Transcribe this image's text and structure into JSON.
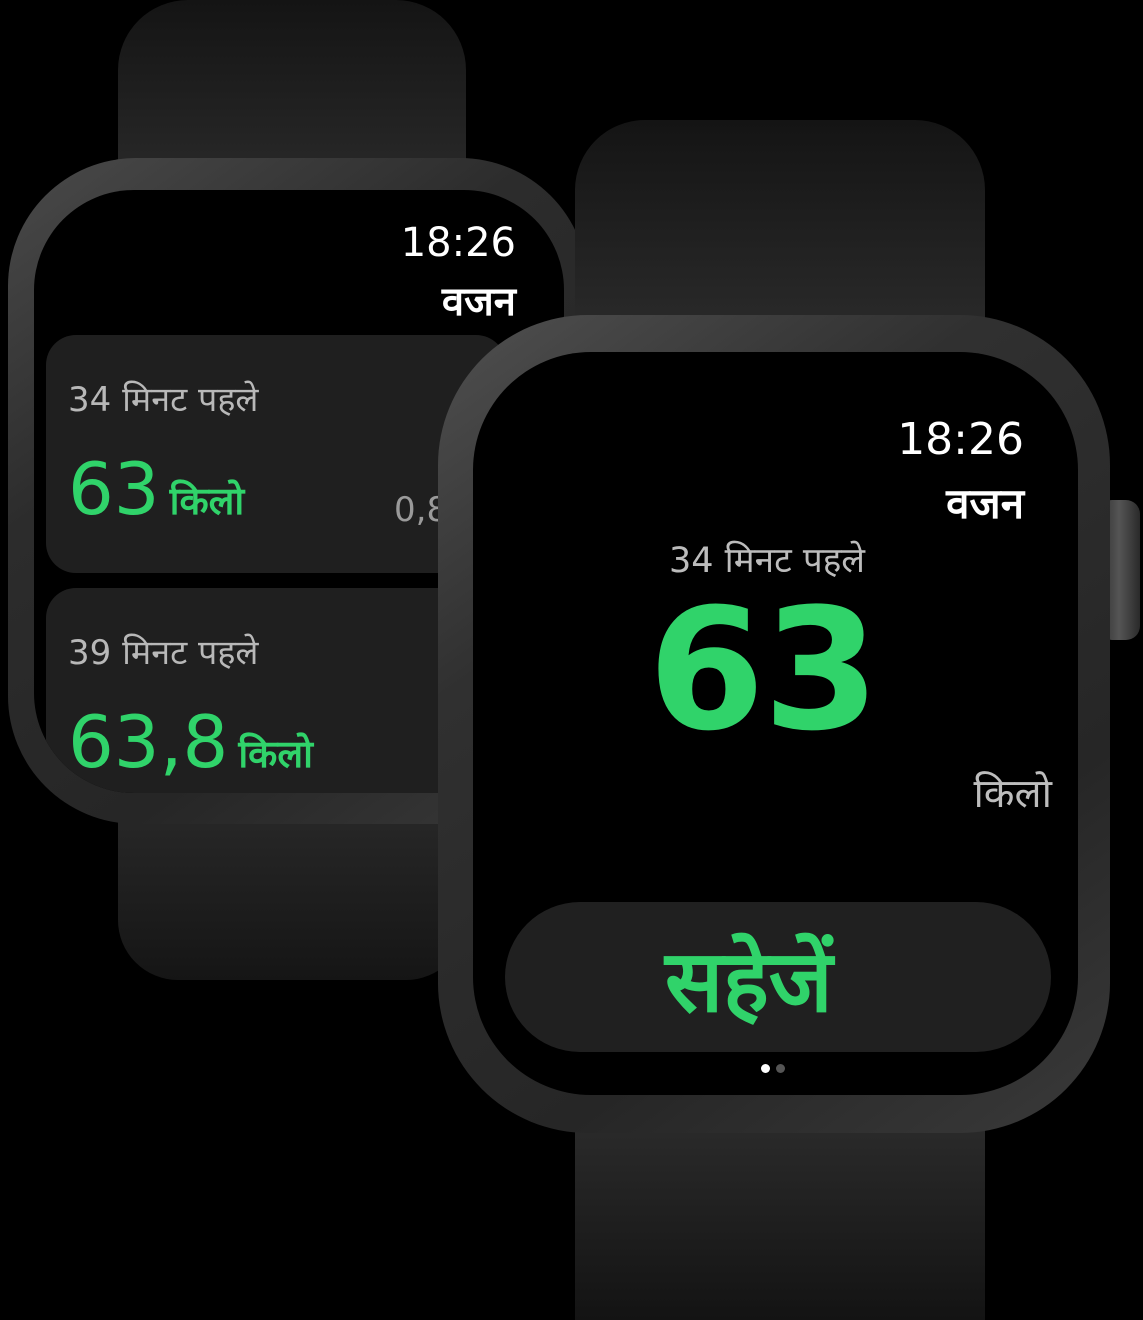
{
  "back_watch": {
    "time": "18:26",
    "title": "वजन",
    "entries": [
      {
        "ago": "34 मिनट पहले",
        "value": "63",
        "unit": "किलो",
        "extra": "0,8"
      },
      {
        "ago": "39 मिनट पहले",
        "value": "63,8",
        "unit": "किलो"
      }
    ]
  },
  "front_watch": {
    "time": "18:26",
    "title": "वजन",
    "ago": "34 मिनट पहले",
    "value": "63",
    "unit": "किलो",
    "save_label": "सहेजें",
    "page_indicator": {
      "current": 1,
      "total": 2
    }
  },
  "colors": {
    "accent": "#30d36a",
    "background": "#000000",
    "card": "#1f1f1f"
  }
}
